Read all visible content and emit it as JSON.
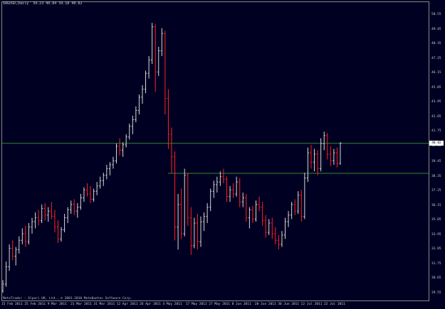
{
  "header": {
    "symbol_info": "XAGUSD,Daily  39.23 40.84 39.18 40.82"
  },
  "footer": {
    "copyright": "MetaTrader - Alpari UK, Ltd., © 2001-2010 MetaQuotes Software Corp."
  },
  "current_price_label": "40.82",
  "colors": {
    "background": "#000022",
    "bar_up": "#d8d8d8",
    "bar_down": "#ff2020",
    "hline": "#2e8b2e",
    "axis_text": "#d0d0d0"
  },
  "chart_data": {
    "type": "ohlc",
    "price_ticks": [
      "50.55",
      "49.45",
      "48.35",
      "47.25",
      "46.15",
      "45.05",
      "43.95",
      "42.85",
      "41.75",
      "40.65",
      "39.45",
      "38.35",
      "37.25",
      "36.15",
      "35.05",
      "33.95",
      "32.85",
      "31.75",
      "30.65",
      "29.55"
    ],
    "time_ticks": [
      "15 Feb 2011",
      "25 Feb 2011",
      "9 Mar 2011",
      "21 Mar 2011",
      "31 Mar 2011",
      "12 Apr 2011",
      "26 Apr 2011",
      "4 May 2011",
      "17 May 2011",
      "27 May 2011",
      "8 Jun 2011",
      "20 Jun 2011",
      "30 Jun 2011",
      "12 Jul 2011",
      "22 Jul 2011"
    ],
    "horizontal_lines": [
      40.82,
      38.55
    ],
    "ylim": [
      29.55,
      51.2
    ],
    "bars": [
      [
        29.7,
        30.5,
        29.55,
        30.2
      ],
      [
        30.2,
        31.9,
        30.0,
        31.5
      ],
      [
        31.5,
        33.2,
        31.2,
        32.9
      ],
      [
        32.9,
        33.5,
        32.0,
        32.3
      ],
      [
        32.3,
        33.0,
        31.6,
        32.8
      ],
      [
        32.8,
        33.8,
        32.5,
        33.5
      ],
      [
        33.5,
        34.4,
        33.2,
        34.0
      ],
      [
        34.0,
        34.6,
        33.0,
        33.4
      ],
      [
        33.4,
        34.8,
        33.2,
        34.5
      ],
      [
        34.5,
        35.2,
        34.0,
        34.9
      ],
      [
        34.9,
        35.6,
        34.4,
        35.2
      ],
      [
        35.2,
        35.8,
        34.6,
        35.0
      ],
      [
        35.0,
        36.2,
        34.8,
        35.9
      ],
      [
        35.9,
        36.3,
        35.0,
        35.4
      ],
      [
        35.4,
        36.0,
        34.9,
        35.7
      ],
      [
        35.7,
        36.4,
        35.1,
        35.3
      ],
      [
        35.3,
        35.8,
        34.1,
        34.5
      ],
      [
        34.5,
        35.0,
        33.3,
        33.6
      ],
      [
        33.6,
        34.5,
        33.4,
        34.3
      ],
      [
        34.3,
        35.5,
        34.1,
        35.2
      ],
      [
        35.2,
        36.0,
        34.8,
        35.8
      ],
      [
        35.8,
        36.5,
        35.5,
        36.2
      ],
      [
        36.2,
        36.6,
        35.4,
        35.7
      ],
      [
        35.7,
        36.3,
        35.2,
        36.0
      ],
      [
        36.0,
        37.0,
        35.8,
        36.7
      ],
      [
        36.7,
        37.5,
        36.4,
        37.3
      ],
      [
        37.3,
        37.8,
        36.8,
        37.0
      ],
      [
        37.0,
        37.6,
        36.3,
        36.6
      ],
      [
        36.6,
        37.4,
        36.4,
        37.2
      ],
      [
        37.2,
        37.9,
        36.9,
        37.6
      ],
      [
        37.6,
        38.3,
        37.4,
        38.0
      ],
      [
        38.0,
        38.6,
        37.6,
        38.4
      ],
      [
        38.4,
        39.2,
        38.1,
        38.9
      ],
      [
        38.9,
        39.4,
        38.4,
        39.2
      ],
      [
        39.2,
        39.8,
        38.9,
        39.5
      ],
      [
        39.5,
        40.8,
        39.3,
        40.6
      ],
      [
        40.6,
        41.2,
        39.9,
        40.3
      ],
      [
        40.3,
        40.9,
        39.8,
        40.7
      ],
      [
        40.7,
        41.5,
        40.5,
        41.3
      ],
      [
        41.3,
        42.3,
        41.1,
        42.1
      ],
      [
        42.1,
        42.9,
        41.5,
        42.6
      ],
      [
        42.6,
        43.6,
        42.4,
        43.3
      ],
      [
        43.3,
        44.5,
        43.0,
        44.3
      ],
      [
        44.3,
        45.2,
        43.8,
        44.9
      ],
      [
        44.9,
        46.3,
        44.6,
        46.1
      ],
      [
        46.1,
        47.4,
        45.7,
        47.1
      ],
      [
        47.1,
        49.9,
        46.8,
        49.6
      ],
      [
        49.6,
        49.8,
        44.7,
        46.2
      ],
      [
        46.2,
        48.1,
        45.9,
        47.8
      ],
      [
        47.8,
        49.5,
        47.4,
        49.1
      ],
      [
        49.1,
        49.3,
        43.0,
        44.2
      ],
      [
        44.2,
        44.9,
        40.4,
        41.5
      ],
      [
        41.5,
        42.0,
        38.6,
        39.8
      ],
      [
        39.8,
        40.2,
        33.5,
        34.5
      ],
      [
        34.5,
        37.0,
        32.8,
        36.2
      ],
      [
        36.2,
        37.4,
        33.6,
        34.0
      ],
      [
        34.0,
        38.9,
        33.8,
        38.4
      ],
      [
        38.4,
        38.6,
        34.6,
        35.2
      ],
      [
        35.2,
        36.0,
        32.4,
        33.1
      ],
      [
        33.1,
        35.2,
        32.9,
        34.8
      ],
      [
        34.8,
        35.5,
        32.8,
        33.4
      ],
      [
        33.4,
        35.3,
        33.0,
        34.9
      ],
      [
        34.9,
        35.6,
        34.2,
        35.3
      ],
      [
        35.3,
        36.3,
        34.8,
        36.0
      ],
      [
        36.0,
        37.4,
        35.7,
        37.2
      ],
      [
        37.2,
        38.0,
        36.7,
        37.7
      ],
      [
        37.7,
        38.3,
        37.1,
        37.9
      ],
      [
        37.9,
        38.7,
        37.6,
        38.3
      ],
      [
        38.3,
        38.9,
        37.8,
        38.1
      ],
      [
        38.1,
        38.3,
        36.4,
        36.8
      ],
      [
        36.8,
        37.6,
        36.4,
        37.3
      ],
      [
        37.3,
        37.8,
        36.7,
        37.0
      ],
      [
        37.0,
        38.3,
        36.8,
        37.9
      ],
      [
        37.9,
        38.2,
        36.0,
        36.4
      ],
      [
        36.4,
        37.1,
        36.0,
        36.7
      ],
      [
        36.7,
        37.0,
        34.9,
        35.2
      ],
      [
        35.2,
        36.0,
        34.4,
        35.8
      ],
      [
        35.8,
        36.1,
        34.8,
        35.1
      ],
      [
        35.1,
        36.5,
        34.9,
        36.2
      ],
      [
        36.2,
        36.8,
        35.7,
        36.0
      ],
      [
        36.0,
        36.4,
        34.6,
        35.0
      ],
      [
        35.0,
        35.4,
        33.7,
        34.1
      ],
      [
        34.1,
        35.1,
        33.9,
        34.8
      ],
      [
        34.8,
        35.2,
        33.6,
        34.0
      ],
      [
        34.0,
        34.5,
        33.2,
        33.5
      ],
      [
        33.5,
        33.9,
        32.8,
        33.2
      ],
      [
        33.2,
        34.2,
        33.0,
        33.9
      ],
      [
        33.9,
        35.2,
        33.6,
        34.9
      ],
      [
        34.9,
        35.7,
        34.5,
        35.4
      ],
      [
        35.4,
        36.4,
        35.1,
        36.2
      ],
      [
        36.2,
        36.6,
        35.4,
        35.7
      ],
      [
        35.7,
        37.2,
        35.5,
        36.9
      ],
      [
        36.9,
        37.3,
        34.9,
        35.3
      ],
      [
        35.3,
        38.6,
        35.1,
        38.2
      ],
      [
        38.2,
        40.5,
        37.9,
        40.1
      ],
      [
        40.1,
        40.7,
        38.9,
        39.4
      ],
      [
        39.4,
        40.4,
        38.7,
        40.0
      ],
      [
        40.0,
        40.3,
        38.4,
        38.9
      ],
      [
        38.9,
        41.2,
        38.7,
        40.8
      ],
      [
        40.8,
        41.7,
        40.3,
        41.4
      ],
      [
        41.4,
        41.6,
        39.6,
        40.0
      ],
      [
        40.0,
        40.6,
        39.1,
        39.5
      ],
      [
        39.5,
        40.4,
        39.2,
        40.1
      ],
      [
        40.1,
        40.5,
        39.0,
        39.3
      ],
      [
        39.3,
        40.9,
        39.2,
        40.82
      ]
    ]
  }
}
